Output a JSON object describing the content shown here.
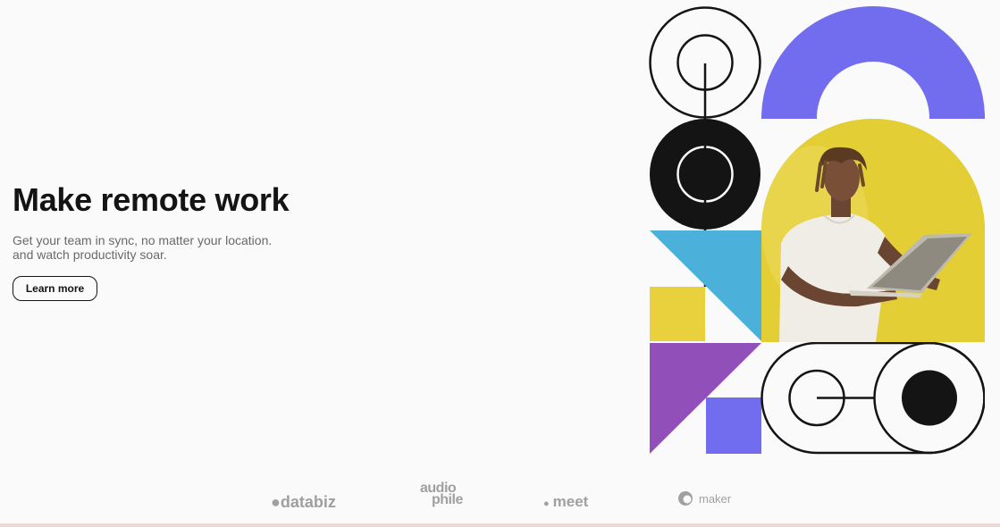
{
  "hero": {
    "title": "Make remote work",
    "subtitle_line1": "Get your team in sync, no matter your location.",
    "subtitle_line2": "and watch productivity soar.",
    "cta_label": "Learn more"
  },
  "clients": {
    "databiz": "databiz",
    "audiophile_top": "audio",
    "audiophile_bottom": "phile",
    "meet": "meet",
    "maker": "maker"
  },
  "colors": {
    "text": "#141414",
    "muted": "#696969",
    "purple_blue": "#726cee",
    "sky_blue": "#4bb1da",
    "yellow": "#e3cf35",
    "purple": "#904fb9",
    "black": "#141414",
    "logo_gray": "#a0a0a0"
  }
}
